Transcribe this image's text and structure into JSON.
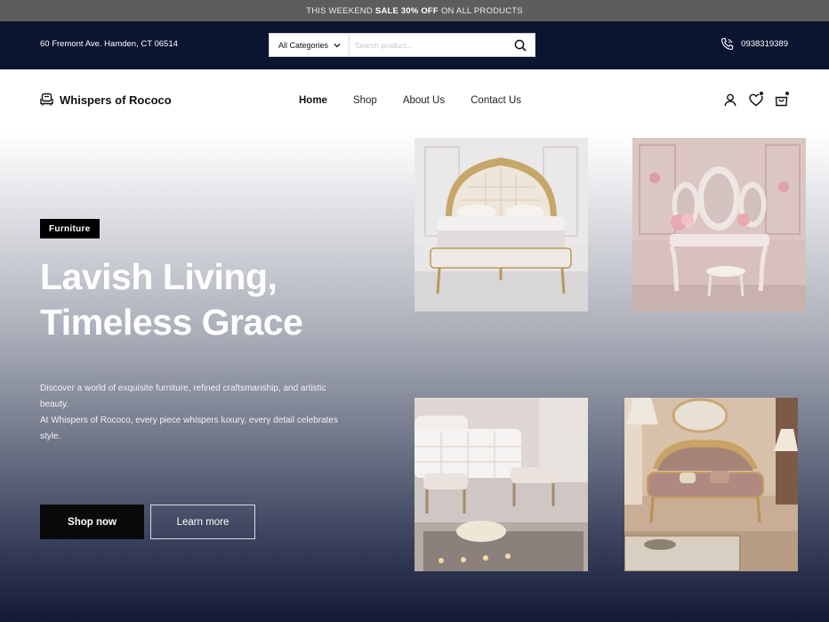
{
  "announcement": {
    "prefix": "THIS WEEKEND",
    "highlight": "SALE 30% OFF",
    "suffix": "ON ALL PRODUCTS"
  },
  "topbar": {
    "address": "60 Fremont Ave. Hamden, CT 06514",
    "category_select": "All Categories",
    "search_placeholder": "Search product...",
    "phone": "0938319389"
  },
  "brand": {
    "name": "Whispers of Rococo"
  },
  "nav": {
    "items": [
      {
        "label": "Home",
        "active": true
      },
      {
        "label": "Shop",
        "active": false
      },
      {
        "label": "About Us",
        "active": false
      },
      {
        "label": "Contact Us",
        "active": false
      }
    ],
    "icons": [
      "user-icon",
      "heart-icon",
      "cart-icon"
    ]
  },
  "hero": {
    "tag": "Furniture",
    "headline_line1": "Lavish Living,",
    "headline_line2": "Timeless Grace",
    "desc_line1": "Discover a world of exquisite furniture, refined craftsmanship, and artistic",
    "desc_line2": "beauty.",
    "desc_line3": "At Whispers of Rococo, every piece whispers luxury, every detail celebrates",
    "desc_line4": "style.",
    "primary_cta": "Shop now",
    "secondary_cta": "Learn more"
  },
  "gallery": [
    {
      "name": "rococo-bed-image"
    },
    {
      "name": "vanity-table-image"
    },
    {
      "name": "bedroom-bench-image"
    },
    {
      "name": "rococo-sofa-image"
    }
  ],
  "colors": {
    "announcement_bg": "#5d5d5d",
    "topbar_bg": "#0c1530",
    "hero_gradient_end": "#121a35",
    "button_primary": "#0a0a0a"
  }
}
